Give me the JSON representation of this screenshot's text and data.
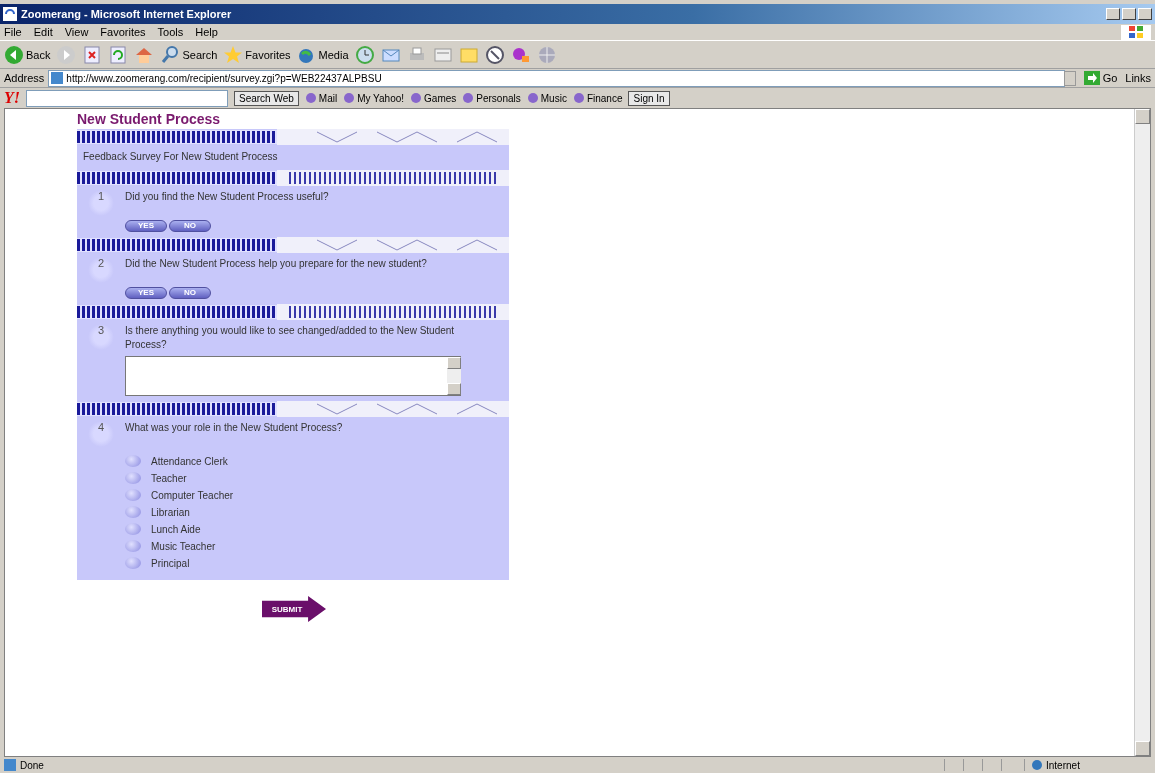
{
  "window": {
    "title": "Zoomerang - Microsoft Internet Explorer"
  },
  "menu": [
    "File",
    "Edit",
    "View",
    "Favorites",
    "Tools",
    "Help"
  ],
  "toolbar": [
    {
      "kind": "back",
      "label": "Back"
    },
    {
      "kind": "forward"
    },
    {
      "kind": "stop"
    },
    {
      "kind": "refresh"
    },
    {
      "kind": "home"
    },
    {
      "kind": "search",
      "label": "Search"
    },
    {
      "kind": "favorites",
      "label": "Favorites"
    },
    {
      "kind": "media",
      "label": "Media"
    },
    {
      "kind": "history"
    },
    {
      "kind": "mail"
    },
    {
      "kind": "print"
    },
    {
      "kind": "edit"
    },
    {
      "kind": "folder"
    },
    {
      "kind": "messenger"
    },
    {
      "kind": "chat"
    },
    {
      "kind": "globe"
    }
  ],
  "address": {
    "label": "Address",
    "value": "http://www.zoomerang.com/recipient/survey.zgi?p=WEB22437ALPBSU",
    "go": "Go",
    "links": "Links"
  },
  "yahoo_bar": {
    "logo": "Y!",
    "search_button": "Search Web",
    "items": [
      "Mail",
      "My Yahoo!",
      "Games",
      "Personals",
      "Music",
      "Finance"
    ],
    "sign_in": "Sign In"
  },
  "survey": {
    "title": "New Student Process",
    "intro": "Feedback Survey For New Student Process",
    "questions": [
      {
        "number": "1",
        "kind": "yesno",
        "text": "Did you find the New Student Process useful?",
        "buttons": [
          "YES",
          "NO"
        ]
      },
      {
        "number": "2",
        "kind": "yesno",
        "text": "Did the New Student Process help you prepare for the new student?",
        "buttons": [
          "YES",
          "NO"
        ]
      },
      {
        "number": "3",
        "kind": "text",
        "text": "Is there anything you would like to see changed/added to the New Student Process?"
      },
      {
        "number": "4",
        "kind": "choice",
        "text": "What was your role in the New Student Process?",
        "options": [
          {
            "label": "Attendance Clerk",
            "selected": false
          },
          {
            "label": "Teacher",
            "selected": false
          },
          {
            "label": "Computer Teacher",
            "selected": false
          },
          {
            "label": "Librarian",
            "selected": false
          },
          {
            "label": "Lunch Aide",
            "selected": false
          },
          {
            "label": "Music Teacher",
            "selected": false
          },
          {
            "label": "Principal",
            "selected": false
          }
        ]
      }
    ],
    "submit": "SUBMIT"
  },
  "status_bar": {
    "text": "Done",
    "zone": "Internet"
  }
}
